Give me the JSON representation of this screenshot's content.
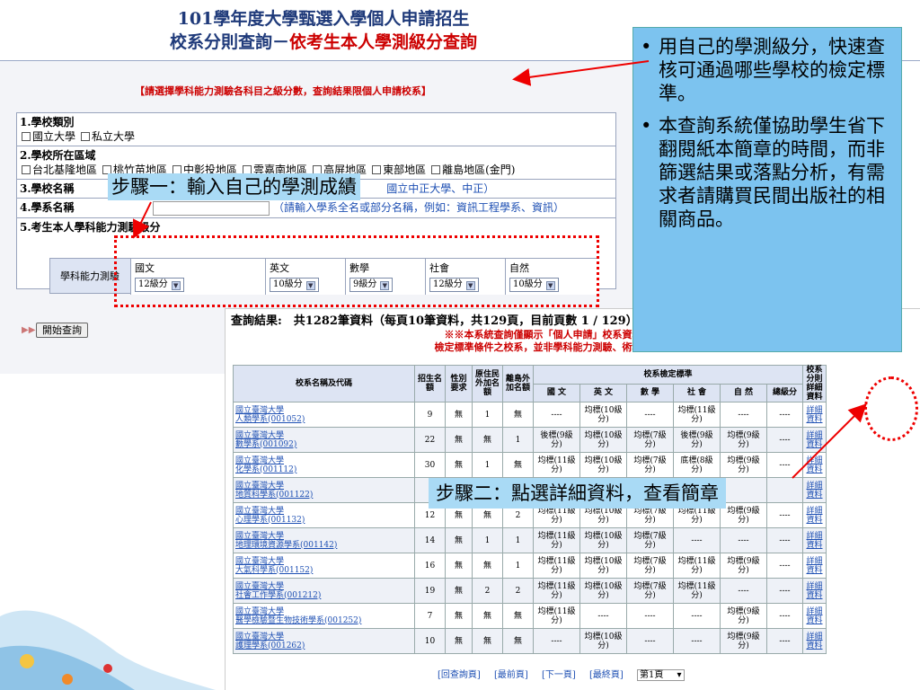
{
  "header": {
    "line1": "101學年度大學甄選入學個人申請招生",
    "line2_prefix": "校系分則查詢－",
    "line2_red": "依考生本人學測級分查詢"
  },
  "notice": "【請選擇學科能力測驗各科目之級分數，查詢結果限個人申請校系】",
  "form": {
    "school_type": {
      "label": "1.學校類別",
      "options": [
        "國立大學",
        "私立大學"
      ]
    },
    "region": {
      "label": "2.學校所在區域",
      "options": [
        "台北基隆地區",
        "桃竹苗地區",
        "中彰投地區",
        "雲嘉南地區",
        "高屏地區",
        "東部地區",
        "離島地區(金門)"
      ]
    },
    "school_name": {
      "label": "3.學校名稱",
      "hint": "國立中正大學、中正）"
    },
    "dept_name": {
      "label": "4.學系名稱",
      "hint": "（請輸入學系全名或部分名稱，例如：資訊工程學系、資訊）"
    },
    "scores": {
      "label": "5.考生本人學科能力測驗級分",
      "row_label": "學科能力測驗",
      "subjects": [
        {
          "name": "國文",
          "value": "12級分"
        },
        {
          "name": "英文",
          "value": "10級分"
        },
        {
          "name": "數學",
          "value": "9級分"
        },
        {
          "name": "社會",
          "value": "12級分"
        },
        {
          "name": "自然",
          "value": "10級分"
        }
      ]
    },
    "search_button": "開始查詢"
  },
  "results": {
    "summary": "查詢結果:　共1282筆資料（每頁10筆資料，共129頁，目前頁數 1 / 129）",
    "note_line1": "※※本系統查詢僅顯示「個人申請」校系資料，查詢",
    "note_line2": "檢定標準條件之校系，並非學科能力測驗、術科考試篩選",
    "headers": {
      "name": "校系名稱及代碼",
      "quota": "招生名額",
      "gender": "性別要求",
      "aboriginal": "原住民外加名額",
      "island": "離島外加名額",
      "standard": "校系檢定標準",
      "detail": "校系分則詳細資料",
      "subjects": [
        "國 文",
        "英 文",
        "數 學",
        "社 會",
        "自 然",
        "總級分"
      ]
    },
    "rows": [
      {
        "school": "國立臺灣大學",
        "dept": "人類學系(001052)",
        "quota": "9",
        "gender": "無",
        "abo": "1",
        "isl": "無",
        "s": [
          "----",
          "均標(10級分)",
          "----",
          "均標(11級分)",
          "----",
          "----"
        ],
        "detail": "詳細資料"
      },
      {
        "school": "國立臺灣大學",
        "dept": "數學系(001092)",
        "quota": "22",
        "gender": "無",
        "abo": "無",
        "isl": "1",
        "s": [
          "後標(9級分)",
          "均標(10級分)",
          "均標(7級分)",
          "後標(9級分)",
          "均標(9級分)",
          "----"
        ],
        "detail": "詳細資料"
      },
      {
        "school": "國立臺灣大學",
        "dept": "化學系(001112)",
        "quota": "30",
        "gender": "無",
        "abo": "1",
        "isl": "無",
        "s": [
          "均標(11級分)",
          "均標(10級分)",
          "均標(7級分)",
          "底標(8級分)",
          "均標(9級分)",
          "----"
        ],
        "detail": "詳細資料"
      },
      {
        "school": "國立臺灣大學",
        "dept": "地質科學系(001122)",
        "quota": "",
        "gender": "",
        "abo": "",
        "isl": "",
        "s": [
          "",
          "",
          "",
          "",
          "",
          ""
        ],
        "detail": "詳細資料"
      },
      {
        "school": "國立臺灣大學",
        "dept": "心理學系(001132)",
        "quota": "12",
        "gender": "無",
        "abo": "無",
        "isl": "2",
        "s": [
          "均標(11級分)",
          "均標(10級分)",
          "均標(7級分)",
          "均標(11級分)",
          "均標(9級分)",
          "----"
        ],
        "detail": "詳細資料"
      },
      {
        "school": "國立臺灣大學",
        "dept": "地理環境資源學系(001142)",
        "quota": "14",
        "gender": "無",
        "abo": "1",
        "isl": "1",
        "s": [
          "均標(11級分)",
          "均標(10級分)",
          "均標(7級分)",
          "----",
          "----",
          "----"
        ],
        "detail": "詳細資料"
      },
      {
        "school": "國立臺灣大學",
        "dept": "大氣科學系(001152)",
        "quota": "16",
        "gender": "無",
        "abo": "無",
        "isl": "1",
        "s": [
          "均標(11級分)",
          "均標(10級分)",
          "均標(7級分)",
          "均標(11級分)",
          "均標(9級分)",
          "----"
        ],
        "detail": "詳細資料"
      },
      {
        "school": "國立臺灣大學",
        "dept": "社會工作學系(001212)",
        "quota": "19",
        "gender": "無",
        "abo": "2",
        "isl": "2",
        "s": [
          "均標(11級分)",
          "均標(10級分)",
          "均標(7級分)",
          "均標(11級分)",
          "----",
          "----"
        ],
        "detail": "詳細資料"
      },
      {
        "school": "國立臺灣大學",
        "dept": "醫學檢驗暨生物技術學系(001252)",
        "quota": "7",
        "gender": "無",
        "abo": "無",
        "isl": "無",
        "s": [
          "均標(11級分)",
          "----",
          "----",
          "----",
          "均標(9級分)",
          "----"
        ],
        "detail": "詳細資料"
      },
      {
        "school": "國立臺灣大學",
        "dept": "護理學系(001262)",
        "quota": "10",
        "gender": "無",
        "abo": "無",
        "isl": "無",
        "s": [
          "----",
          "均標(10級分)",
          "----",
          "----",
          "均標(9級分)",
          "----"
        ],
        "detail": "詳細資料"
      }
    ],
    "pager": {
      "back": "[回查詢頁]",
      "first": "[最前頁]",
      "next": "[下一頁]",
      "last": "[最終頁]",
      "page": "第1頁"
    }
  },
  "callout": {
    "points": [
      "用自己的學測級分，快速查核可通過哪些學校的檢定標準。",
      "本查詢系統僅協助學生省下翻閱紙本簡章的時間，而非篩選結果或落點分析，有需求者請購買民間出版社的相關商品。"
    ]
  },
  "steps": {
    "step1": "步驟一：輸入自己的學測成績",
    "step2": "步驟二：點選詳細資料，查看簡章"
  },
  "colors": {
    "callout_bg": "#7cc3ef",
    "step_bg": "#a9daf5",
    "annotation_red": "#e00000"
  }
}
